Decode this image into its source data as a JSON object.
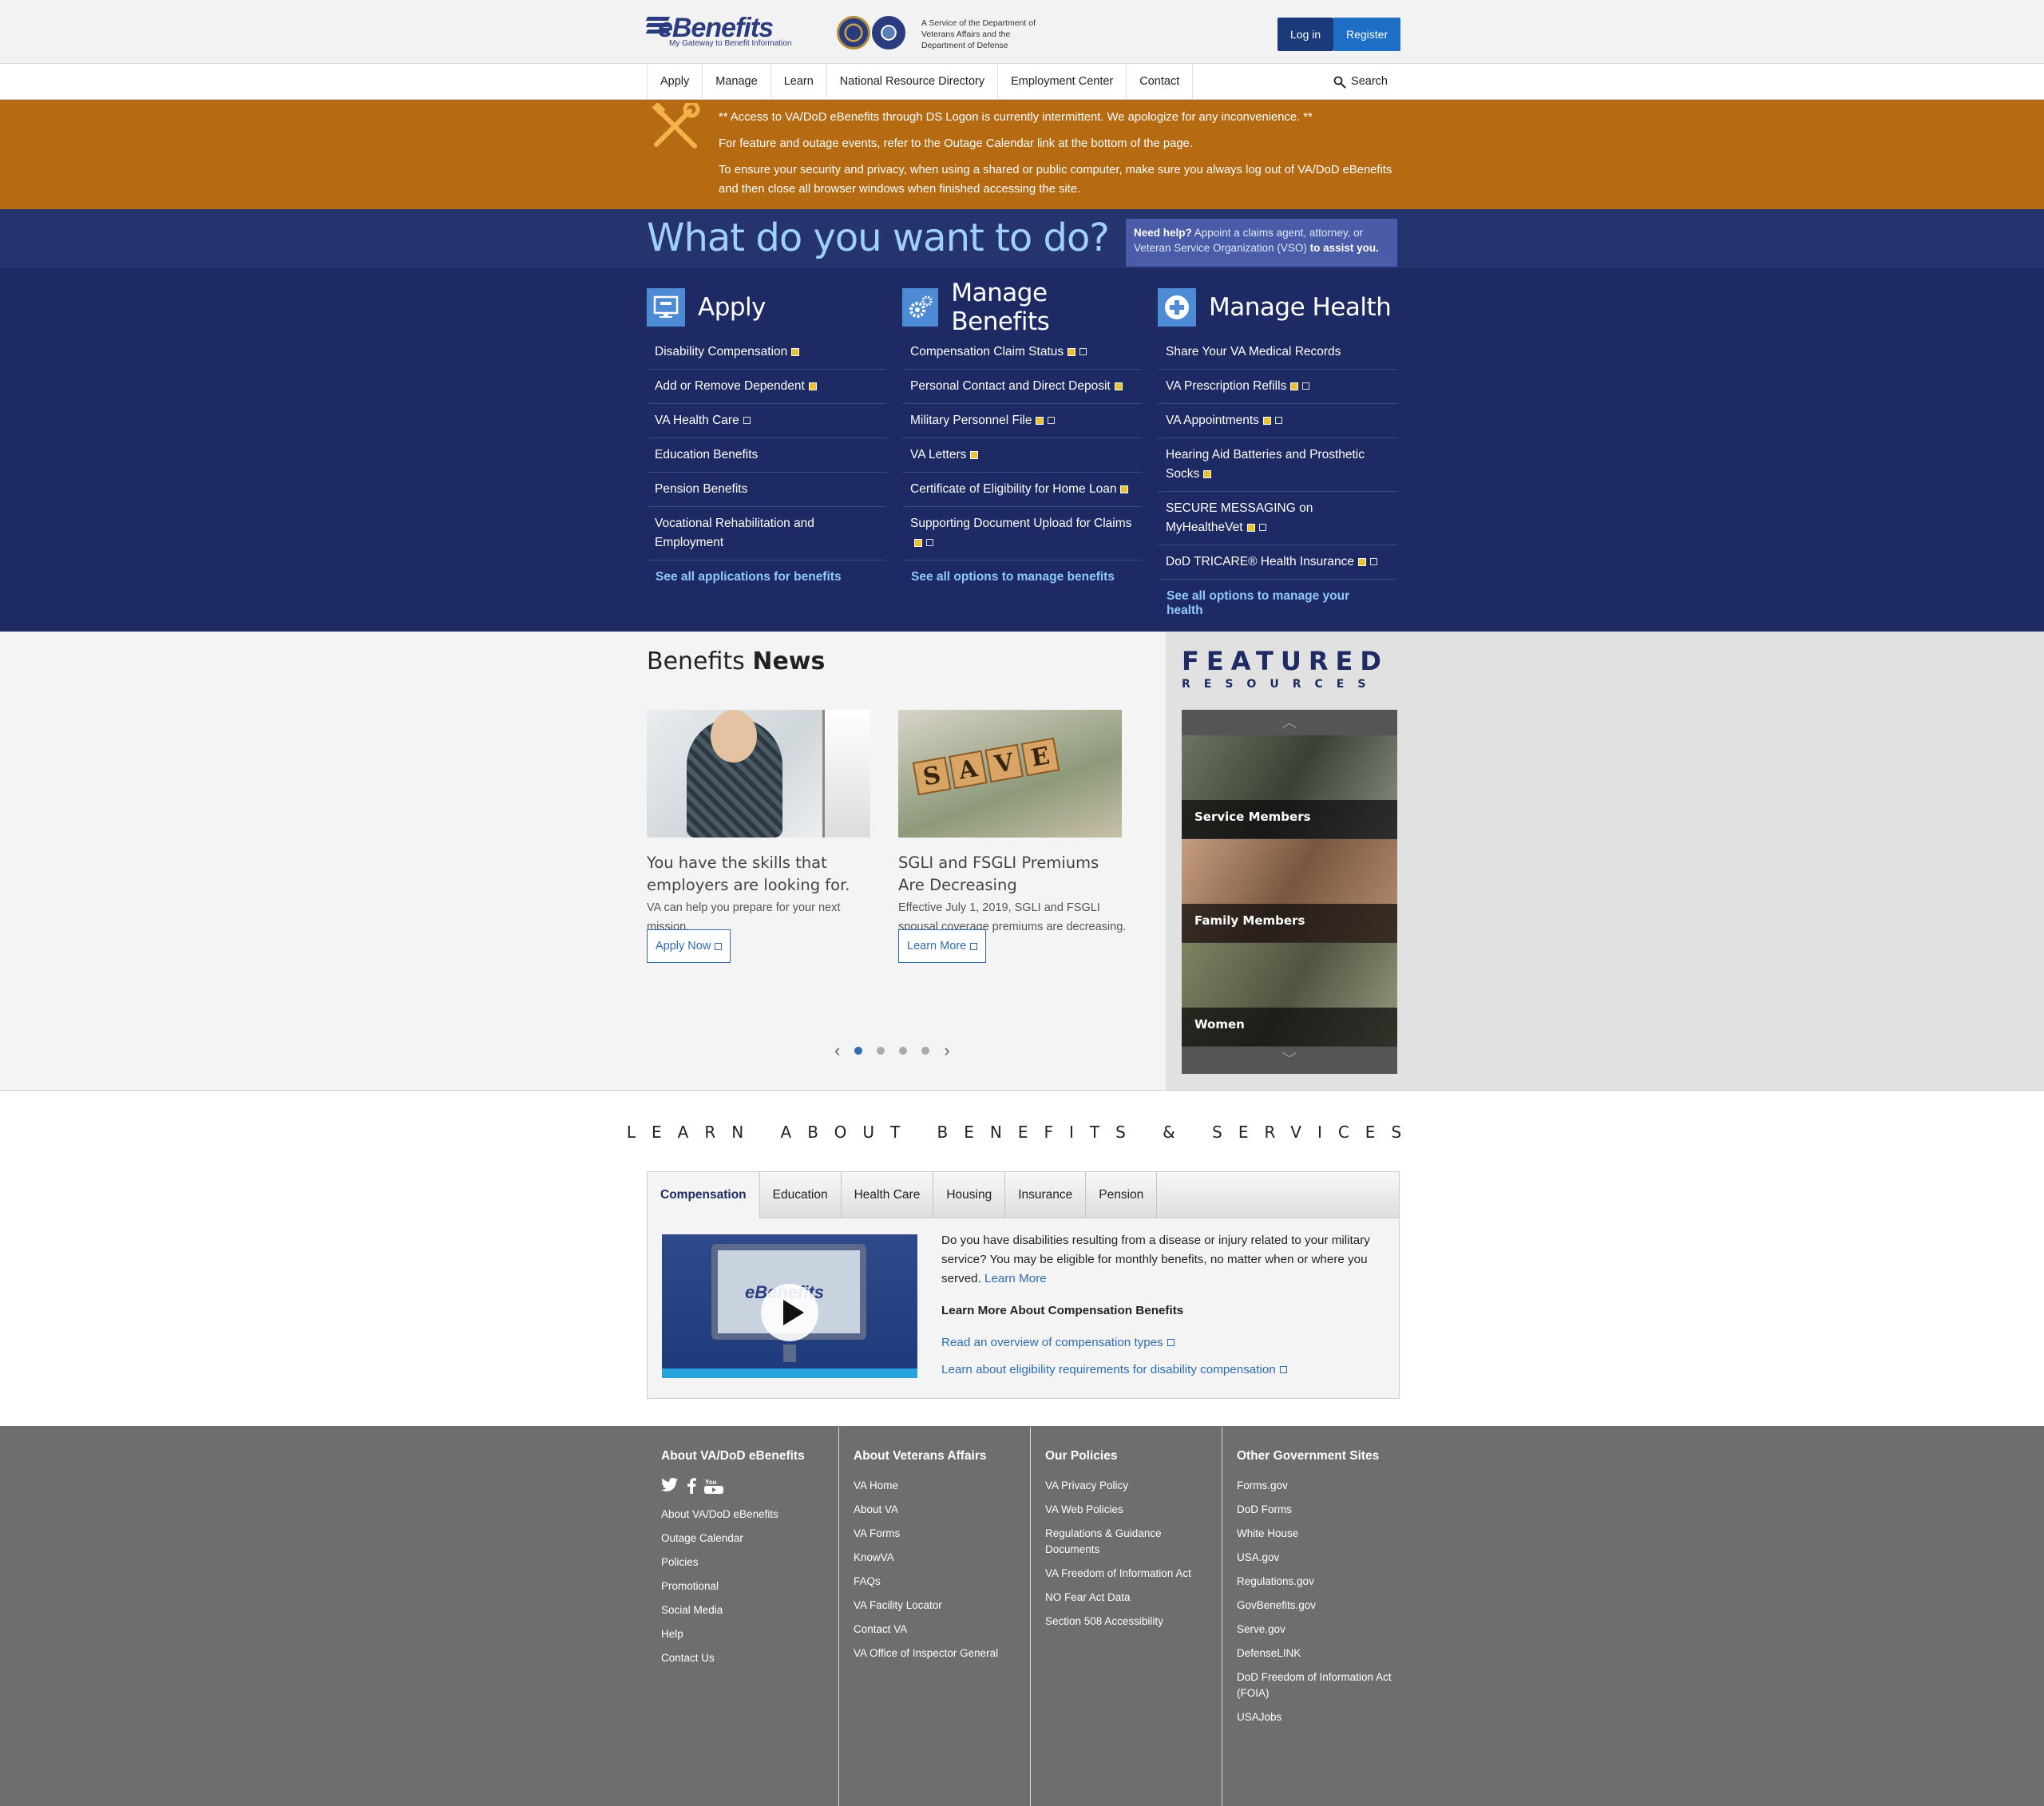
{
  "header": {
    "logo_text": "eBenefits",
    "logo_tagline": "My Gateway to Benefit Information",
    "service_text": "A Service of the Department of Veterans Affairs and the Department of Defense",
    "login_label": "Log in",
    "register_label": "Register"
  },
  "nav": {
    "items": [
      "Apply",
      "Manage",
      "Learn",
      "National Resource Directory",
      "Employment Center",
      "Contact"
    ],
    "search_label": "Search"
  },
  "alert": {
    "line1": "** Access to VA/DoD eBenefits through DS Logon is currently intermittent. We apologize for any inconvenience. **",
    "line2": "For feature and outage events, refer to the Outage Calendar link at the bottom of the page.",
    "line3": "To ensure your security and privacy, when using a shared or public computer, make sure you always log out of VA/DoD eBenefits and then close all browser windows when finished accessing the site."
  },
  "want": {
    "title": "What do you want to do?",
    "help_bold": "Need help?",
    "help_text": " Appoint a claims agent, attorney, or Veteran Service Organization (VSO) ",
    "help_bold2": "to assist you."
  },
  "apply": {
    "title": "Apply",
    "items": [
      "Disability Compensation",
      "Add or Remove Dependent",
      "VA Health Care",
      "Education Benefits",
      "Pension Benefits",
      "Vocational Rehabilitation and Employment"
    ],
    "more": "See all applications for benefits"
  },
  "manage": {
    "title": "Manage Benefits",
    "items": [
      "Compensation Claim Status",
      "Personal Contact and Direct Deposit",
      "Military Personnel File",
      "VA Letters",
      "Certificate of Eligibility for Home Loan",
      "Supporting Document Upload for Claims"
    ],
    "more": "See all options to manage benefits"
  },
  "health": {
    "title": "Manage Health",
    "items": [
      "Share Your VA Medical Records",
      "VA Prescription Refills",
      "VA Appointments",
      "Hearing Aid Batteries and Prosthetic Socks",
      "SECURE MESSAGING on MyHealtheVet",
      "DoD TRICARE® Health Insurance"
    ],
    "more": "See all options to manage your health"
  },
  "news": {
    "title_light": "Benefits ",
    "title_bold": "News",
    "cards": [
      {
        "heading": "You have the skills that employers are looking for.",
        "body": "VA can help you prepare for your next mission.",
        "button": "Apply Now"
      },
      {
        "heading": "SGLI and FSGLI Premiums Are Decreasing",
        "body": "Effective July 1, 2019, SGLI and FSGLI spousal coverage premiums are decreasing.",
        "button": "Learn More"
      }
    ],
    "save_tiles": [
      "S",
      "A",
      "V",
      "E"
    ]
  },
  "featured": {
    "title": "FEATURED",
    "subtitle": "RESOURCES",
    "items": [
      "Service Members",
      "Family Members",
      "Women"
    ]
  },
  "learn": {
    "title": "LEARN ABOUT BENEFITS & SERVICES",
    "tabs": [
      "Compensation",
      "Education",
      "Health Care",
      "Housing",
      "Insurance",
      "Pension"
    ],
    "video_text": "eBenefits",
    "body": "Do you have disabilities resulting from a disease or injury related to your military service? You may be eligible for monthly benefits, no matter when or where you served. ",
    "learn_more": "Learn More",
    "subheading": "Learn More About Compensation Benefits",
    "link1": "Read an overview of compensation types",
    "link2": "Learn about eligibility requirements for disability compensation"
  },
  "footer": {
    "col1": {
      "title": "About VA/DoD eBenefits",
      "items": [
        "About VA/DoD eBenefits",
        "Outage Calendar",
        "Policies",
        "Promotional",
        "Social Media",
        "Help",
        "Contact Us"
      ]
    },
    "col2": {
      "title": "About Veterans Affairs",
      "items": [
        "VA Home",
        "About VA",
        "VA Forms",
        "KnowVA",
        "FAQs",
        "VA Facility Locator",
        "Contact VA",
        "VA Office of Inspector General"
      ]
    },
    "col3": {
      "title": "Our Policies",
      "items": [
        "VA Privacy Policy",
        "VA Web Policies",
        "Regulations & Guidance Documents",
        "VA Freedom of Information Act",
        "NO Fear Act Data",
        "Section 508 Accessibility"
      ]
    },
    "col4": {
      "title": "Other Government Sites",
      "items": [
        "Forms.gov",
        "DoD Forms",
        "White House",
        "USA.gov",
        "Regulations.gov",
        "GovBenefits.gov",
        "Serve.gov",
        "DefenseLINK",
        "DoD Freedom of Information Act (FOIA)",
        "USAJobs"
      ]
    }
  },
  "colors": {
    "navy": "#1d2a63",
    "alert": "#b66a12",
    "link": "#2d6bb3",
    "light_blue": "#9fd0ff"
  }
}
